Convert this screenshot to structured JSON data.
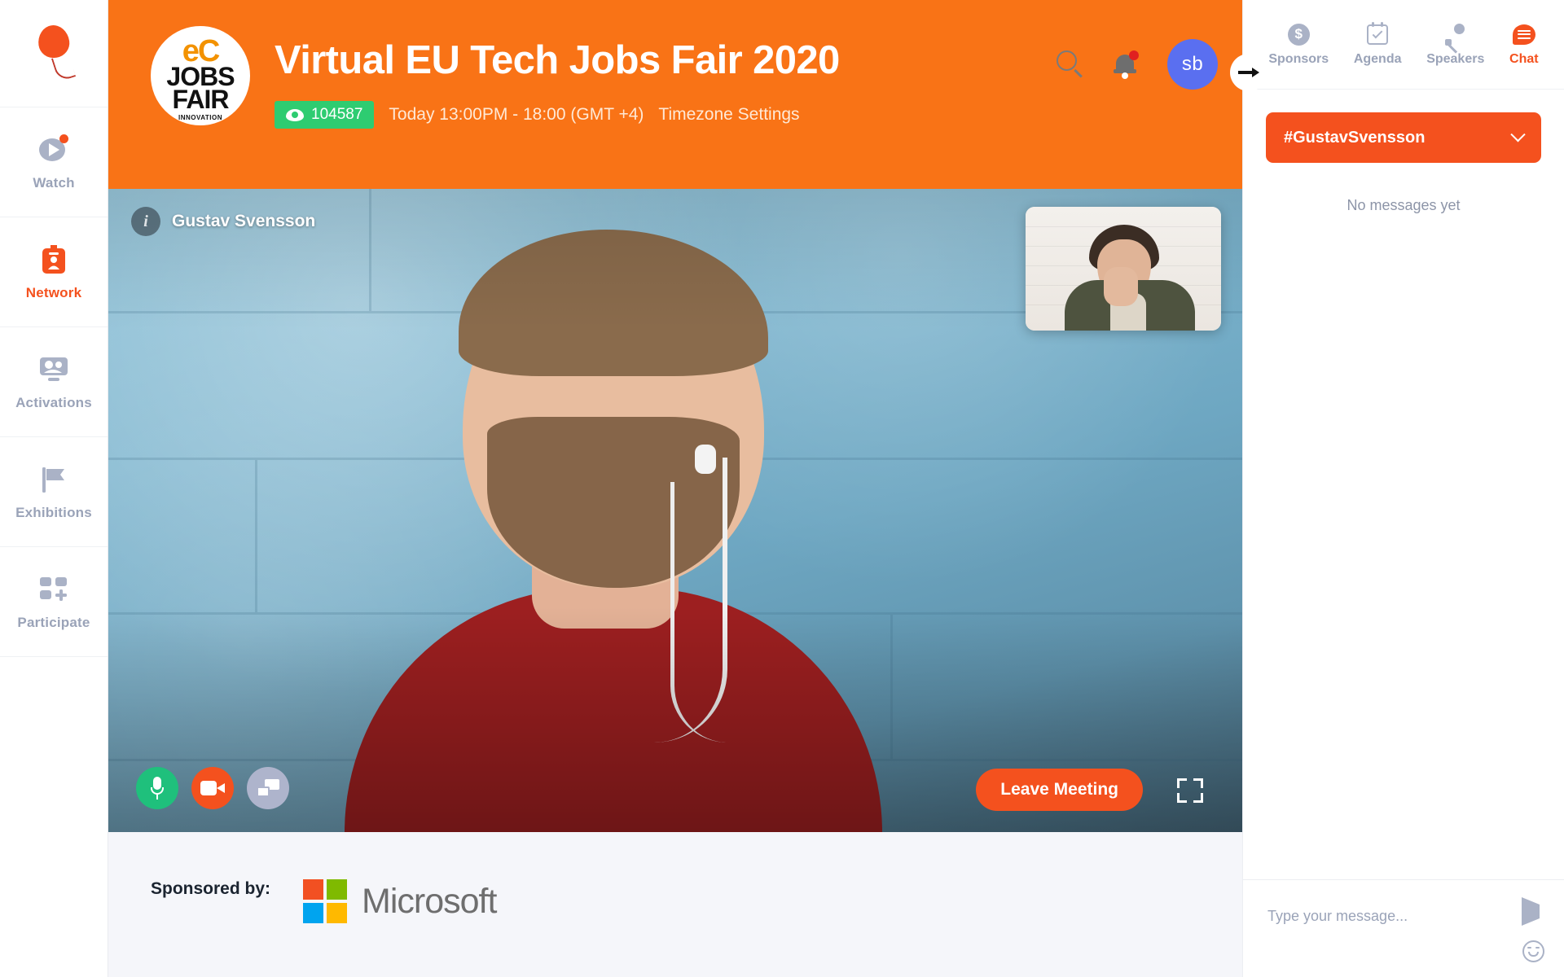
{
  "sidebar": {
    "logo_icon": "balloon-icon",
    "items": [
      {
        "label": "Watch",
        "icon": "play-circle-icon",
        "active": false,
        "has_badge": true
      },
      {
        "label": "Network",
        "icon": "id-badge-icon",
        "active": true,
        "has_badge": false
      },
      {
        "label": "Activations",
        "icon": "screen-people-icon",
        "active": false,
        "has_badge": false
      },
      {
        "label": "Exhibitions",
        "icon": "flag-icon",
        "active": false,
        "has_badge": false
      },
      {
        "label": "Participate",
        "icon": "grid-plus-icon",
        "active": false,
        "has_badge": false
      }
    ]
  },
  "header": {
    "logo": {
      "top_text": "eC",
      "line1": "JOBS",
      "line2": "FAIR",
      "footer_text": "INNOVATION"
    },
    "title": "Virtual EU Tech Jobs Fair 2020",
    "views_count": "104587",
    "views_icon": "eye-icon",
    "time_text": "Today 13:00PM - 18:00 (GMT +4)",
    "timezone_link": "Timezone Settings",
    "search_icon": "search-icon",
    "bell_icon": "bell-icon",
    "avatar_initials": "sb",
    "collapse_icon": "arrow-right-icon",
    "accent_color": "#f97316",
    "badge_color": "#2ecc71"
  },
  "stage": {
    "info_icon": "info-icon",
    "presenter_name": "Gustav Svensson",
    "pip_label": "self-video-thumbnail",
    "controls": [
      {
        "name": "microphone-toggle",
        "icon": "microphone-icon",
        "color": "#1fc07c"
      },
      {
        "name": "camera-toggle",
        "icon": "video-camera-icon",
        "color": "#f4511e"
      },
      {
        "name": "screen-share-toggle",
        "icon": "screen-share-icon",
        "color": "#aeb4cc"
      }
    ],
    "leave_label": "Leave Meeting",
    "fullscreen_icon": "fullscreen-icon"
  },
  "sponsor": {
    "label": "Sponsored by:",
    "brand": "Microsoft",
    "logo_colors": [
      "#f25022",
      "#7fba00",
      "#00a4ef",
      "#ffb900"
    ]
  },
  "right_panel": {
    "tabs": [
      {
        "label": "Sponsors",
        "icon": "dollar-circle-icon",
        "active": false
      },
      {
        "label": "Agenda",
        "icon": "calendar-check-icon",
        "active": false
      },
      {
        "label": "Speakers",
        "icon": "microphone-icon",
        "active": false
      },
      {
        "label": "Chat",
        "icon": "chat-bubble-icon",
        "active": true
      }
    ],
    "channel": "#GustavSvensson",
    "channel_chevron": "chevron-down-icon",
    "empty_state": "No messages yet",
    "composer_placeholder": "Type your message...",
    "send_icon": "send-icon",
    "emoji_icon": "emoji-icon",
    "accent_color": "#f4511e"
  }
}
